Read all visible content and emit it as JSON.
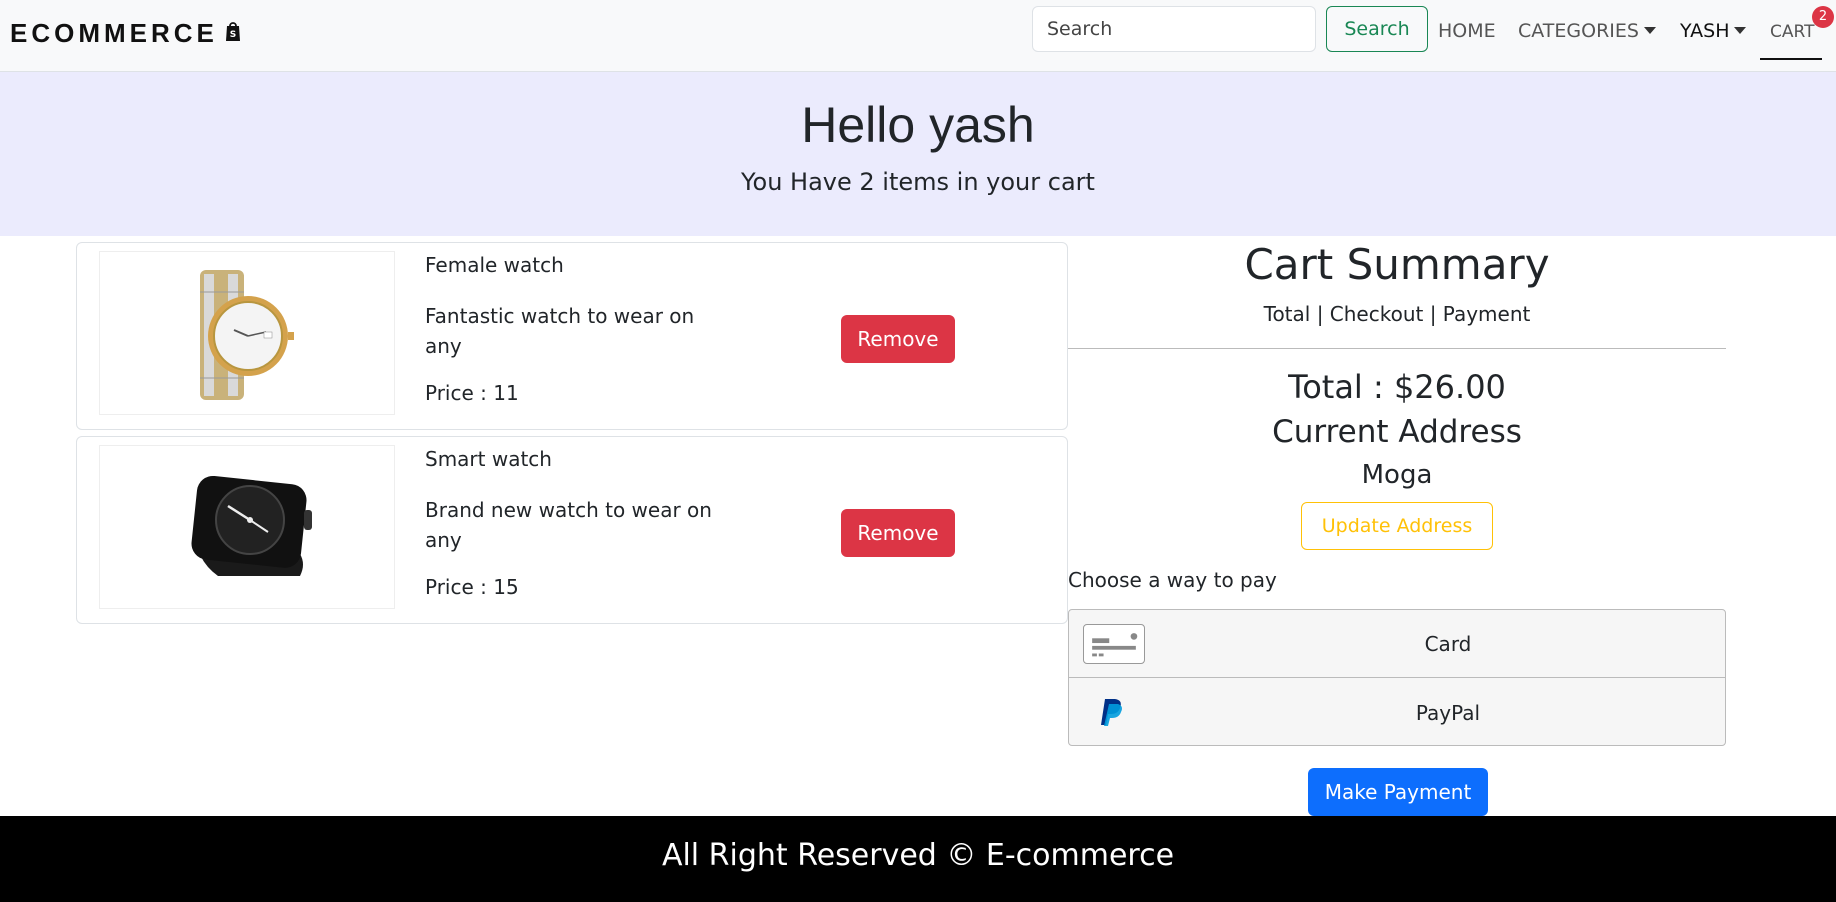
{
  "navbar": {
    "brand": "ECOMMERCE",
    "brand_icon": "shopify-bag-icon",
    "search_placeholder": "Search",
    "search_button": "Search",
    "home": "HOME",
    "categories": "CATEGORIES",
    "user": "YASH",
    "cart": "CART",
    "cart_count": "2"
  },
  "hero": {
    "title": "Hello yash",
    "subtitle": "You Have 2 items in your cart"
  },
  "cart_items": [
    {
      "name": "Female watch",
      "description": "Fantastic watch to wear on any",
      "price": "Price : 11",
      "remove_label": "Remove",
      "image": "gold-silver-wristwatch"
    },
    {
      "name": "Smart watch",
      "description": "Brand new watch to wear on any",
      "price": "Price : 15",
      "remove_label": "Remove",
      "image": "black-smartwatch"
    }
  ],
  "summary": {
    "title": "Cart Summary",
    "subtitle": "Total | Checkout | Payment",
    "total": "Total : $26.00",
    "address_label": "Current Address",
    "address": "Moga",
    "update_address": "Update Address",
    "pay_label": "Choose a way to pay",
    "pay_options": [
      {
        "label": "Card",
        "icon": "credit-card-icon"
      },
      {
        "label": "PayPal",
        "icon": "paypal-icon"
      }
    ],
    "make_payment": "Make Payment"
  },
  "footer": {
    "text": "All Right Reserved © E-commerce"
  },
  "colors": {
    "hero_bg": "#ebebfd",
    "danger": "#dc3545",
    "success": "#198754",
    "warning": "#ffc107",
    "primary": "#0d6efd"
  }
}
